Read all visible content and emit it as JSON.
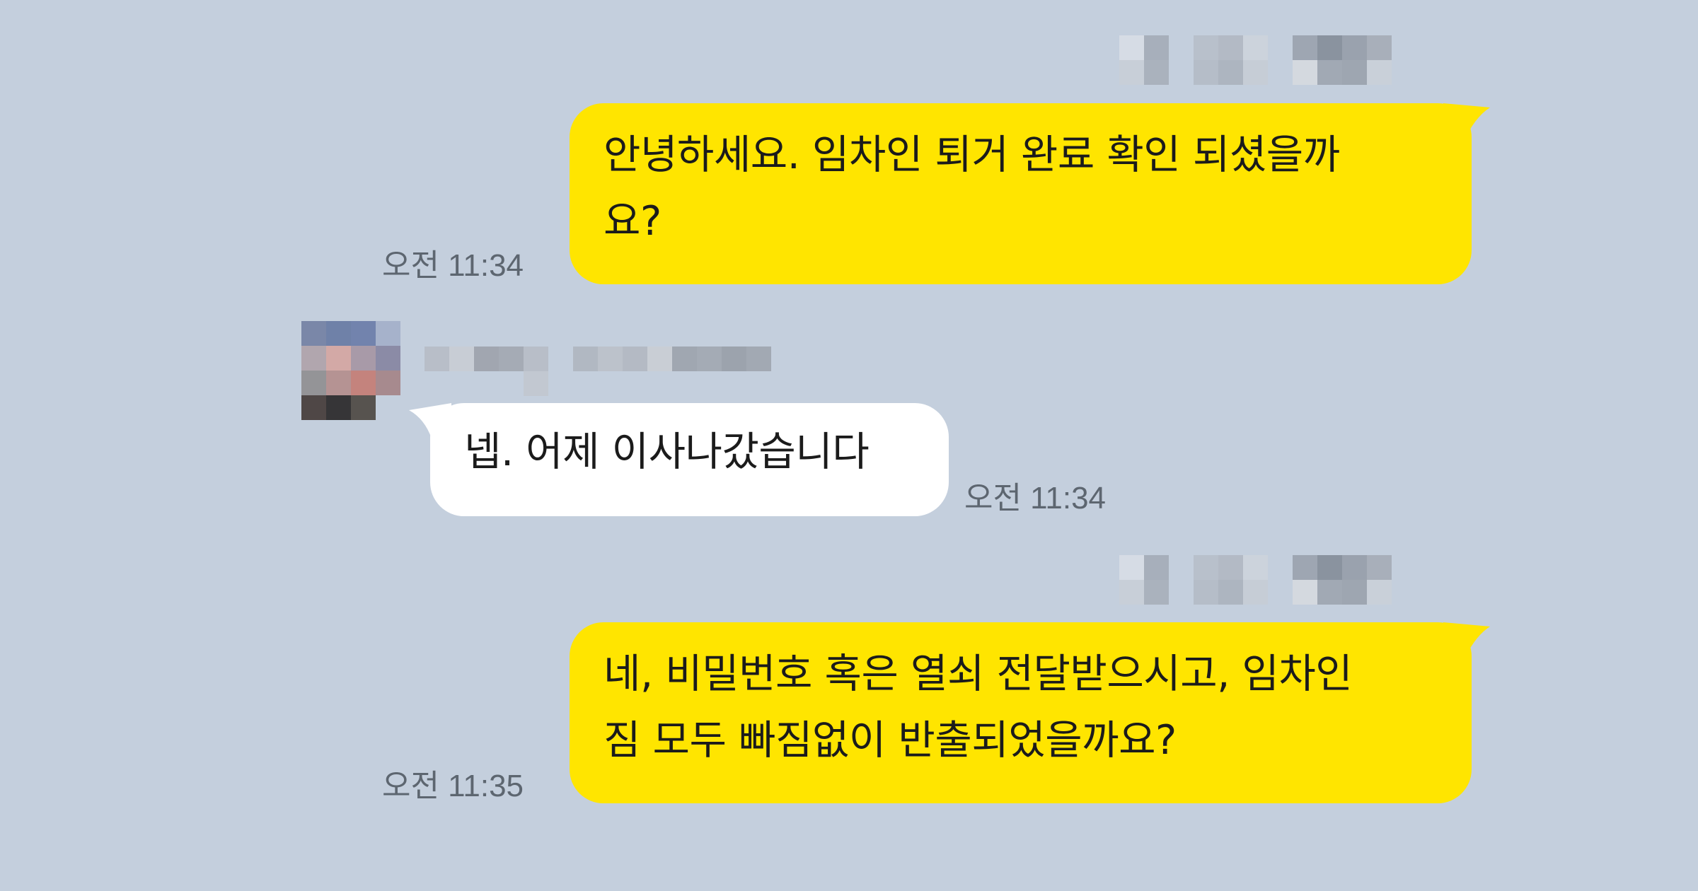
{
  "chat": {
    "messages": [
      {
        "id": "msg-1",
        "sender": "me",
        "lines": [
          "안녕하세요. 임차인 퇴거 완료 확인 되셨을까",
          "요?"
        ],
        "time": "오전 11:34"
      },
      {
        "id": "msg-2",
        "sender": "other",
        "lines": [
          "넵. 어제 이사나갔습니다"
        ],
        "time": "오전 11:34"
      },
      {
        "id": "msg-3",
        "sender": "me",
        "lines": [
          "네, 비밀번호 혹은 열쇠 전달받으시고, 임차인",
          "짐 모두 빠짐없이 반출되었을까요?"
        ],
        "time": "오전 11:35"
      }
    ]
  },
  "colors": {
    "background": "#c4cfdd",
    "my_bubble": "#ffe500",
    "other_bubble": "#ffffff",
    "timestamp": "#5d6670"
  }
}
